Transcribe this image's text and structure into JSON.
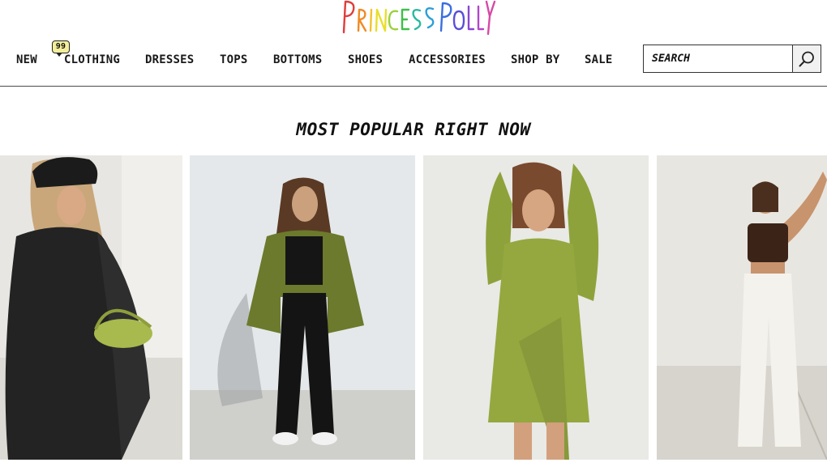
{
  "brand": {
    "name": "PRINCESS POLLY"
  },
  "nav": {
    "items": [
      {
        "label": "NEW",
        "badge": "99"
      },
      {
        "label": "CLOTHING"
      },
      {
        "label": "DRESSES"
      },
      {
        "label": "TOPS"
      },
      {
        "label": "BOTTOMS"
      },
      {
        "label": "SHOES"
      },
      {
        "label": "ACCESSORIES"
      },
      {
        "label": "SHOP BY"
      },
      {
        "label": "SALE"
      }
    ]
  },
  "search": {
    "placeholder": "SEARCH",
    "icon": "search-icon"
  },
  "section": {
    "title": "MOST POPULAR RIGHT NOW"
  },
  "products": [
    {
      "image": "model-black-leather-blazer-green-bag"
    },
    {
      "image": "model-green-leather-jacket-black-pants"
    },
    {
      "image": "model-green-wrap-romper"
    },
    {
      "image": "model-brown-crop-white-pants"
    }
  ],
  "colors": {
    "accent": "#f3ee9a",
    "text": "#111111",
    "divider": "#4a4a4a"
  }
}
